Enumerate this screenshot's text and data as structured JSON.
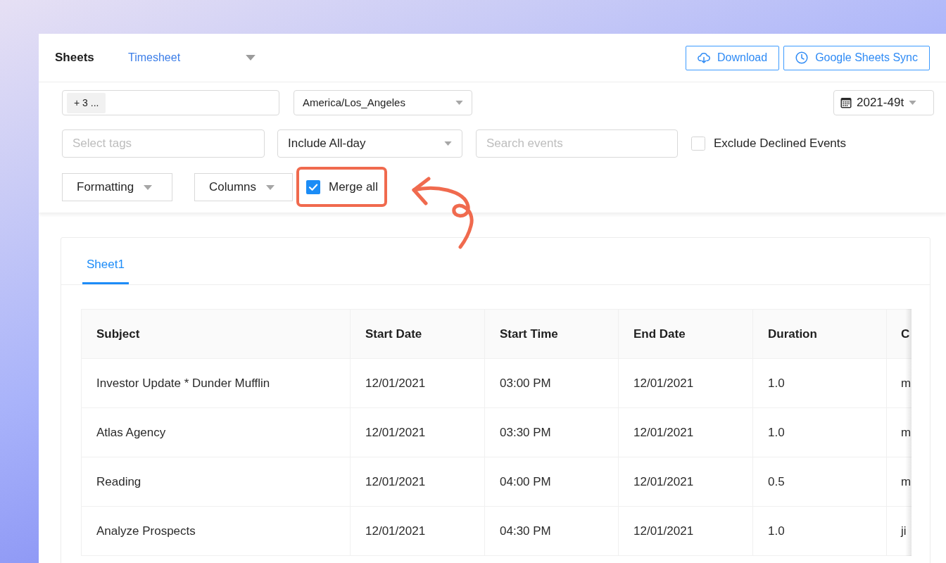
{
  "header": {
    "title": "Sheets",
    "sheet_select": {
      "value": "Timesheet"
    },
    "buttons": [
      {
        "kind": "download",
        "label": "Download"
      },
      {
        "kind": "sync",
        "label": "Google Sheets Sync"
      }
    ]
  },
  "filters": {
    "calendars": {
      "chip": "+ 3 ..."
    },
    "timezone": {
      "value": "America/Los_Angeles"
    },
    "week": {
      "value": "2021-49t"
    },
    "tags": {
      "placeholder": "Select tags"
    },
    "all_day": {
      "value": "Include All-day"
    },
    "search": {
      "placeholder": "Search events"
    },
    "exclude_declined": {
      "label": "Exclude Declined Events",
      "checked": false
    },
    "formatting": {
      "label": "Formatting"
    },
    "columns": {
      "label": "Columns"
    },
    "merge_all": {
      "label": "Merge all",
      "checked": true
    }
  },
  "tabs": [
    {
      "label": "Sheet1",
      "selected": true
    }
  ],
  "table": {
    "columns": [
      "Subject",
      "Start Date",
      "Start Time",
      "End Date",
      "Duration",
      "C"
    ],
    "rows": [
      [
        "Investor Update * Dunder Mufflin",
        "12/01/2021",
        "03:00 PM",
        "12/01/2021",
        "1.0",
        "m"
      ],
      [
        "Atlas Agency",
        "12/01/2021",
        "03:30 PM",
        "12/01/2021",
        "1.0",
        "m"
      ],
      [
        "Reading",
        "12/01/2021",
        "04:00 PM",
        "12/01/2021",
        "0.5",
        "m"
      ],
      [
        "Analyze Prospects",
        "12/01/2021",
        "04:30 PM",
        "12/01/2021",
        "1.0",
        "ji"
      ]
    ]
  }
}
